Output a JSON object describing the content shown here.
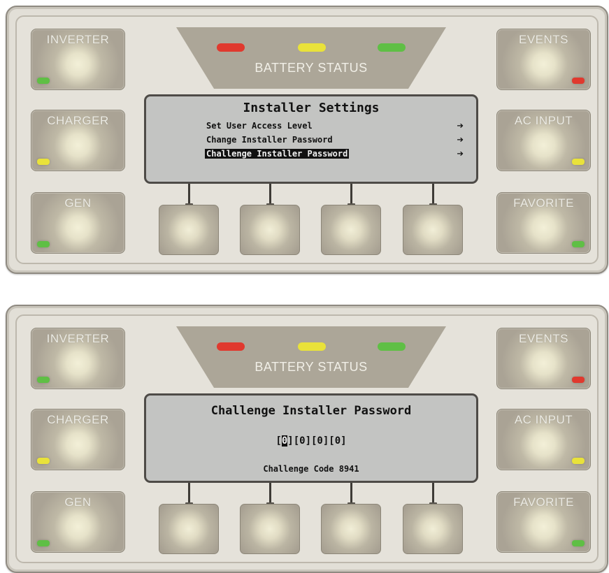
{
  "colors": {
    "led_red": "#e0392e",
    "led_yellow": "#e9e23a",
    "led_green": "#5fbf45"
  },
  "panels": [
    {
      "side_buttons": {
        "inverter": "INVERTER",
        "charger": "CHARGER",
        "gen": "GEN",
        "events": "EVENTS",
        "ac_input": "AC INPUT",
        "favorite": "FAVORITE"
      },
      "battery_status_label": "BATTERY STATUS",
      "screen": {
        "title": "Installer Settings",
        "menu": [
          {
            "label": "Set User Access Level",
            "arrow": "➔"
          },
          {
            "label": "Change Installer Password",
            "arrow": "➔"
          },
          {
            "label": "Challenge Installer Password",
            "arrow": "➔"
          }
        ]
      }
    },
    {
      "side_buttons": {
        "inverter": "INVERTER",
        "charger": "CHARGER",
        "gen": "GEN",
        "events": "EVENTS",
        "ac_input": "AC INPUT",
        "favorite": "FAVORITE"
      },
      "battery_status_label": "BATTERY STATUS",
      "screen": {
        "title": "Challenge Installer Password",
        "digits": [
          "0",
          "0",
          "0",
          "0"
        ],
        "challenge_code": "Challenge Code 8941"
      }
    }
  ]
}
